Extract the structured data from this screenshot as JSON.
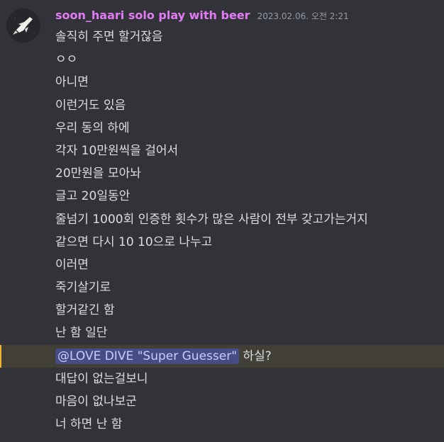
{
  "message": {
    "author": "soon_haari solo play with beer",
    "timestamp": "2023.02.06. 오전 2:21",
    "lines": [
      "솔직히 주면 할거잖음",
      "ㅇㅇ",
      "아니면",
      "이런거도 있음",
      "우리 동의 하에",
      "각자 10만원씩을 걸어서",
      "20만원을 모아놔",
      "글고 20일동안",
      "줄넘기 1000회 인증한 횟수가 많은 사람이 전부 갖고가는거지",
      "같으면 다시 10 10으로 나누고",
      "이러면",
      "죽기살기로",
      "할거같긴 함",
      "난 함 일단"
    ],
    "mention_line": {
      "mention": "@LOVE DIVE \"Super Guesser\"",
      "text": " 하실?"
    },
    "after_lines": [
      "대답이 없는걸보니",
      "마음이 없나보군",
      "너 하면 난 함"
    ]
  },
  "colors": {
    "background": "#313338",
    "username": "#e37cf4",
    "timestamp": "#949ba4",
    "text": "#dbdee1",
    "highlight_bg": "#423f37",
    "highlight_bar": "#f0b232",
    "mention_bg": "#474c85",
    "mention_text": "#c9cdfb"
  },
  "icons": {
    "avatar": "avatar-image"
  }
}
